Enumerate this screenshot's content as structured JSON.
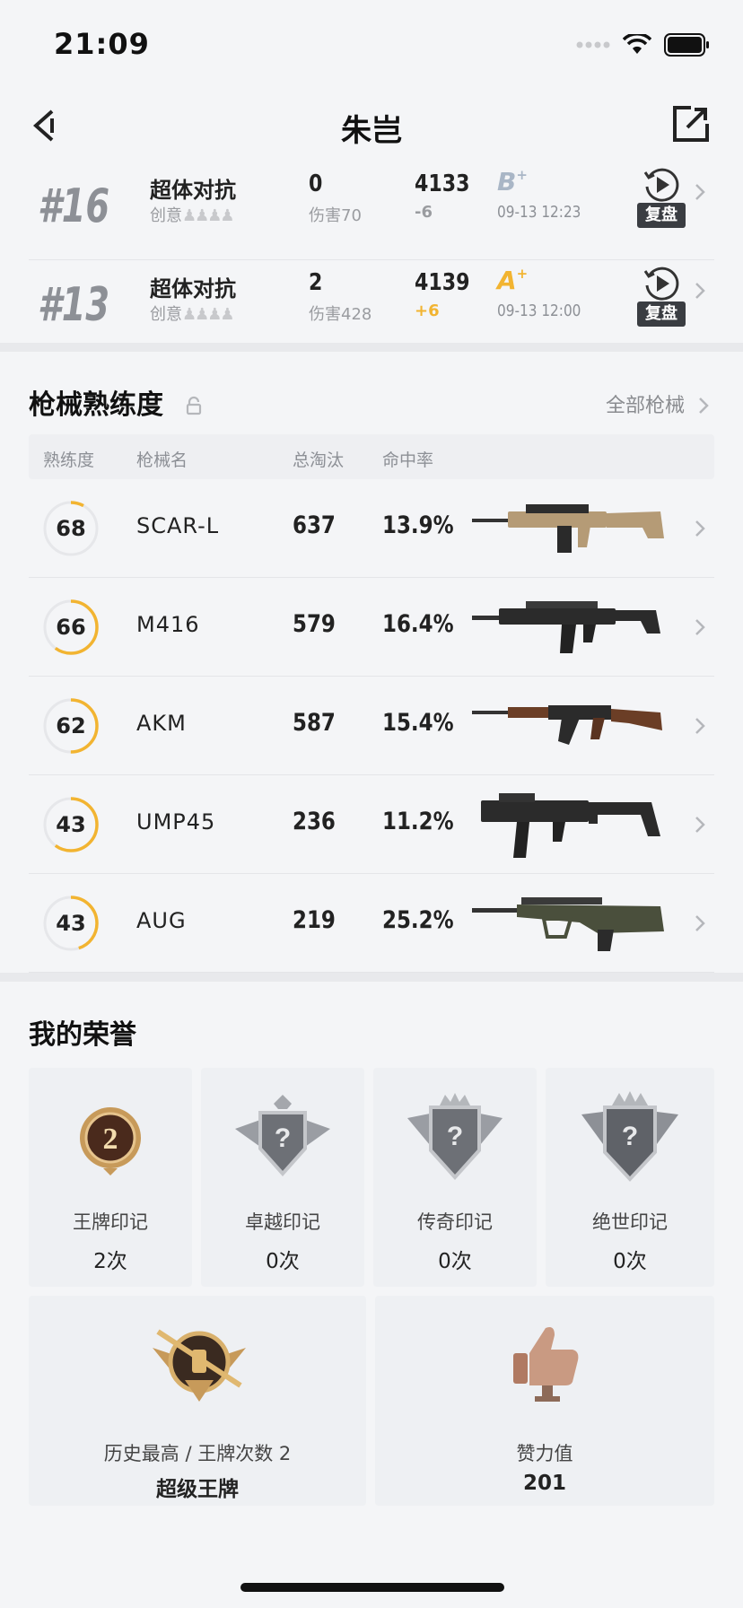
{
  "status_bar": {
    "time": "21:09"
  },
  "nav": {
    "title": "朱岂"
  },
  "matches": [
    {
      "rank": "#16",
      "mode": "超体对抗",
      "sub": "创意",
      "kills": "0",
      "damage": "伤害70",
      "rating": "4133",
      "delta": "-6",
      "delta_positive": false,
      "grade": "B",
      "grade_mod": "+",
      "grade_color": "#a9b6c6",
      "time": "09-13 12:23",
      "replay": "复盘"
    },
    {
      "rank": "#13",
      "mode": "超体对抗",
      "sub": "创意",
      "kills": "2",
      "damage": "伤害428",
      "rating": "4139",
      "delta": "+6",
      "delta_positive": true,
      "grade": "A",
      "grade_mod": "+",
      "grade_color": "#f2b431",
      "time": "09-13 12:00",
      "replay": "复盘"
    }
  ],
  "guns_section": {
    "title": "枪械熟练度",
    "all_link": "全部枪械",
    "headers": [
      "熟练度",
      "枪械名",
      "总淘汰",
      "命中率"
    ],
    "rows": [
      {
        "mastery": "68",
        "name": "SCAR-L",
        "kills": "637",
        "accuracy": "13.9%",
        "progress": 0.08,
        "icon": "scar-l-rifle-image"
      },
      {
        "mastery": "66",
        "name": "M416",
        "kills": "579",
        "accuracy": "16.4%",
        "progress": 0.6,
        "icon": "m416-rifle-image"
      },
      {
        "mastery": "62",
        "name": "AKM",
        "kills": "587",
        "accuracy": "15.4%",
        "progress": 0.5,
        "icon": "akm-rifle-image"
      },
      {
        "mastery": "43",
        "name": "UMP45",
        "kills": "236",
        "accuracy": "11.2%",
        "progress": 0.6,
        "icon": "ump45-smg-image"
      },
      {
        "mastery": "43",
        "name": "AUG",
        "kills": "219",
        "accuracy": "25.2%",
        "progress": 0.45,
        "icon": "aug-rifle-image"
      }
    ]
  },
  "honors_section": {
    "title": "我的荣誉",
    "marks": [
      {
        "label": "王牌印记",
        "value": "2次",
        "icon": "ace-mark-medal-icon",
        "badge_text": "2"
      },
      {
        "label": "卓越印记",
        "value": "0次",
        "icon": "excellence-mark-icon",
        "badge_text": "?"
      },
      {
        "label": "传奇印记",
        "value": "0次",
        "icon": "legend-mark-icon",
        "badge_text": "?"
      },
      {
        "label": "绝世印记",
        "value": "0次",
        "icon": "peerless-mark-icon",
        "badge_text": "?"
      }
    ],
    "highest": {
      "label": "历史最高 / 王牌次数 2",
      "value": "超级王牌",
      "icon": "super-ace-badge-icon"
    },
    "likes": {
      "label": "赞力值",
      "value": "201",
      "icon": "thumbs-up-trophy-icon"
    }
  },
  "colors": {
    "accent_yellow": "#f2b431",
    "ring_track": "#e6e7ea",
    "background": "#f4f5f7"
  }
}
